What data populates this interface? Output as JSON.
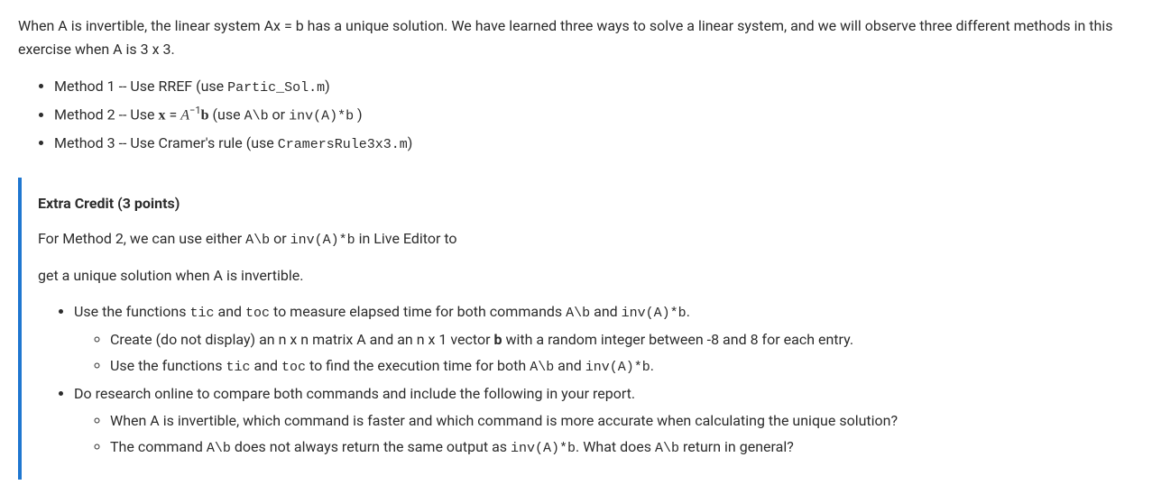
{
  "intro": "When A is invertible, the linear system Ax = b has a unique solution.  We have learned three ways to solve a linear system, and we will observe three different methods in this exercise when A is 3 x 3.",
  "methods": {
    "m1_prefix": "Method 1 -- Use RREF (use ",
    "m1_code": "Partic_Sol.m",
    "m1_suffix": ")",
    "m2_prefix": "Method 2 -- Use ",
    "m2_math_x": "x",
    "m2_math_eq": " = ",
    "m2_math_A": "A",
    "m2_math_exp": "−1",
    "m2_math_b": "b",
    "m2_use_open": "  (use ",
    "m2_code1": "A\\b",
    "m2_or": " or ",
    "m2_code2": "inv(A)*b",
    "m2_close": " )",
    "m3_prefix": "Method 3 -- Use Cramer's rule (use ",
    "m3_code": "CramersRule3x3.m",
    "m3_suffix": ")"
  },
  "callout": {
    "title": "Extra Credit (3 points)",
    "p1_a": "For Method 2, we can use either ",
    "p1_code1": "A\\b",
    "p1_b": " or ",
    "p1_code2": "inv(A)*b",
    "p1_c": " in Live Editor to",
    "p2": "get a unique solution when A is invertible.",
    "b1_a": "Use the functions ",
    "b1_code1": "tic",
    "b1_b": " and ",
    "b1_code2": "toc",
    "b1_c": " to measure elapsed time for both commands ",
    "b1_code3": "A\\b",
    "b1_d": " and ",
    "b1_code4": "inv(A)*b",
    "b1_e": ".",
    "b1_1_a": "Create (do not display) an n x n matrix A and an n x 1 vector ",
    "b1_1_b_bold": "b",
    "b1_1_c": " with a random integer between -8 and 8 for each entry.",
    "b1_2_a": "Use the functions ",
    "b1_2_code1": "tic",
    "b1_2_b": " and ",
    "b1_2_code2": "toc",
    "b1_2_c": " to find the execution time for both ",
    "b1_2_code3": "A\\b",
    "b1_2_d": " and ",
    "b1_2_code4": "inv(A)*b",
    "b1_2_e": ".",
    "b2": "Do research online to compare both commands and include the following in your report.",
    "b2_1": "When A is invertible, which command is faster and which command is more accurate when calculating the unique solution?",
    "b2_2_a": "The command ",
    "b2_2_code1": "A\\b",
    "b2_2_b": " does not always return the same output as ",
    "b2_2_code2": "inv(A)*b",
    "b2_2_c": ". What does ",
    "b2_2_code3": "A\\b",
    "b2_2_d": " return in general?"
  }
}
